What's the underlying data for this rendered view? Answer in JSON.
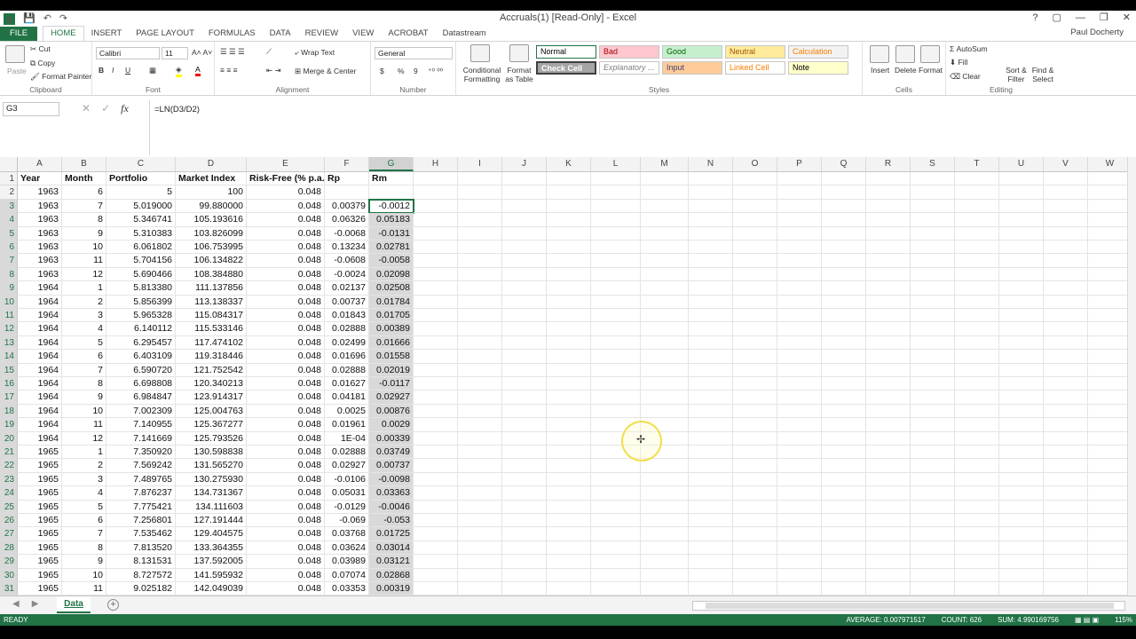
{
  "window": {
    "title": "Accruals(1)  [Read-Only] - Excel",
    "user": "Paul Docherty",
    "help": "?",
    "controls": [
      "▢",
      "—",
      "❐",
      "✕"
    ]
  },
  "qat": [
    "💾",
    "↶",
    "↷"
  ],
  "tabs": [
    "FILE",
    "HOME",
    "INSERT",
    "PAGE LAYOUT",
    "FORMULAS",
    "DATA",
    "REVIEW",
    "VIEW",
    "ACROBAT",
    "Datastream"
  ],
  "ribbon": {
    "clipboard": {
      "label": "Clipboard",
      "paste": "Paste",
      "cut": "Cut",
      "copy": "Copy",
      "format_painter": "Format Painter"
    },
    "font": {
      "label": "Font",
      "name": "Calibri",
      "size": "11",
      "bold": "B",
      "italic": "I",
      "underline": "U"
    },
    "alignment": {
      "label": "Alignment",
      "wrap": "Wrap Text",
      "merge": "Merge & Center"
    },
    "number": {
      "label": "Number",
      "format": "General",
      "currency": "$",
      "percent": "%",
      "comma": "9"
    },
    "styles": {
      "label": "Styles",
      "conditional": "Conditional Formatting",
      "format_table": "Format as Table",
      "cells": [
        {
          "name": "Normal",
          "bg": "#ffffff",
          "fg": "#000000"
        },
        {
          "name": "Bad",
          "bg": "#ffc7ce",
          "fg": "#9c0006"
        },
        {
          "name": "Good",
          "bg": "#c6efce",
          "fg": "#006100"
        },
        {
          "name": "Neutral",
          "bg": "#ffeb9c",
          "fg": "#9c5700"
        },
        {
          "name": "Calculation",
          "bg": "#f2f2f2",
          "fg": "#fa7d00"
        },
        {
          "name": "Check Cell",
          "bg": "#a5a5a5",
          "fg": "#ffffff"
        },
        {
          "name": "Explanatory ...",
          "bg": "#ffffff",
          "fg": "#7f7f7f"
        },
        {
          "name": "Input",
          "bg": "#ffcc99",
          "fg": "#3f3f76"
        },
        {
          "name": "Linked Cell",
          "bg": "#ffffff",
          "fg": "#fa7d00"
        },
        {
          "name": "Note",
          "bg": "#ffffcc",
          "fg": "#000000"
        }
      ]
    },
    "cells": {
      "label": "Cells",
      "insert": "Insert",
      "delete": "Delete",
      "format": "Format"
    },
    "editing": {
      "label": "Editing",
      "autosum": "AutoSum",
      "fill": "Fill",
      "clear": "Clear",
      "sort": "Sort & Filter",
      "find": "Find & Select"
    }
  },
  "formula_bar": {
    "name_box": "G3",
    "formula": "=LN(D3/D2)"
  },
  "columns": [
    "A",
    "B",
    "C",
    "D",
    "E",
    "F",
    "G",
    "H",
    "I",
    "J",
    "K",
    "L",
    "M",
    "N",
    "O",
    "P",
    "Q",
    "R",
    "S",
    "T",
    "U",
    "V",
    "W"
  ],
  "headers": [
    "Year",
    "Month",
    "Portfolio",
    "Market Index",
    "Risk-Free (% p.a.)",
    "Rp",
    "Rm"
  ],
  "rows": [
    [
      "1963",
      "6",
      "5",
      "100",
      "0.048",
      "",
      ""
    ],
    [
      "1963",
      "7",
      "5.019000",
      "99.880000",
      "0.048",
      "0.00379",
      "-0.0012"
    ],
    [
      "1963",
      "8",
      "5.346741",
      "105.193616",
      "0.048",
      "0.06326",
      "0.05183"
    ],
    [
      "1963",
      "9",
      "5.310383",
      "103.826099",
      "0.048",
      "-0.0068",
      "-0.0131"
    ],
    [
      "1963",
      "10",
      "6.061802",
      "106.753995",
      "0.048",
      "0.13234",
      "0.02781"
    ],
    [
      "1963",
      "11",
      "5.704156",
      "106.134822",
      "0.048",
      "-0.0608",
      "-0.0058"
    ],
    [
      "1963",
      "12",
      "5.690466",
      "108.384880",
      "0.048",
      "-0.0024",
      "0.02098"
    ],
    [
      "1964",
      "1",
      "5.813380",
      "111.137856",
      "0.048",
      "0.02137",
      "0.02508"
    ],
    [
      "1964",
      "2",
      "5.856399",
      "113.138337",
      "0.048",
      "0.00737",
      "0.01784"
    ],
    [
      "1964",
      "3",
      "5.965328",
      "115.084317",
      "0.048",
      "0.01843",
      "0.01705"
    ],
    [
      "1964",
      "4",
      "6.140112",
      "115.533146",
      "0.048",
      "0.02888",
      "0.00389"
    ],
    [
      "1964",
      "5",
      "6.295457",
      "117.474102",
      "0.048",
      "0.02499",
      "0.01666"
    ],
    [
      "1964",
      "6",
      "6.403109",
      "119.318446",
      "0.048",
      "0.01696",
      "0.01558"
    ],
    [
      "1964",
      "7",
      "6.590720",
      "121.752542",
      "0.048",
      "0.02888",
      "0.02019"
    ],
    [
      "1964",
      "8",
      "6.698808",
      "120.340213",
      "0.048",
      "0.01627",
      "-0.0117"
    ],
    [
      "1964",
      "9",
      "6.984847",
      "123.914317",
      "0.048",
      "0.04181",
      "0.02927"
    ],
    [
      "1964",
      "10",
      "7.002309",
      "125.004763",
      "0.048",
      "0.0025",
      "0.00876"
    ],
    [
      "1964",
      "11",
      "7.140955",
      "125.367277",
      "0.048",
      "0.01961",
      "0.0029"
    ],
    [
      "1964",
      "12",
      "7.141669",
      "125.793526",
      "0.048",
      "1E-04",
      "0.00339"
    ],
    [
      "1965",
      "1",
      "7.350920",
      "130.598838",
      "0.048",
      "0.02888",
      "0.03749"
    ],
    [
      "1965",
      "2",
      "7.569242",
      "131.565270",
      "0.048",
      "0.02927",
      "0.00737"
    ],
    [
      "1965",
      "3",
      "7.489765",
      "130.275930",
      "0.048",
      "-0.0106",
      "-0.0098"
    ],
    [
      "1965",
      "4",
      "7.876237",
      "134.731367",
      "0.048",
      "0.05031",
      "0.03363"
    ],
    [
      "1965",
      "5",
      "7.775421",
      "134.111603",
      "0.048",
      "-0.0129",
      "-0.0046"
    ],
    [
      "1965",
      "6",
      "7.256801",
      "127.191444",
      "0.048",
      "-0.069",
      "-0.053"
    ],
    [
      "1965",
      "7",
      "7.535462",
      "129.404575",
      "0.048",
      "0.03768",
      "0.01725"
    ],
    [
      "1965",
      "8",
      "7.813520",
      "133.364355",
      "0.048",
      "0.03624",
      "0.03014"
    ],
    [
      "1965",
      "9",
      "8.131531",
      "137.592005",
      "0.048",
      "0.03989",
      "0.03121"
    ],
    [
      "1965",
      "10",
      "8.727572",
      "141.595932",
      "0.048",
      "0.07074",
      "0.02868"
    ],
    [
      "1965",
      "11",
      "9.025182",
      "142.049039",
      "0.048",
      "0.03353",
      "0.00319"
    ]
  ],
  "sheet_tab": "Data",
  "status": {
    "mode": "READY",
    "average": "AVERAGE: 0.007971517",
    "count": "COUNT: 626",
    "sum": "SUM: 4.990169756",
    "zoom": "115%"
  }
}
